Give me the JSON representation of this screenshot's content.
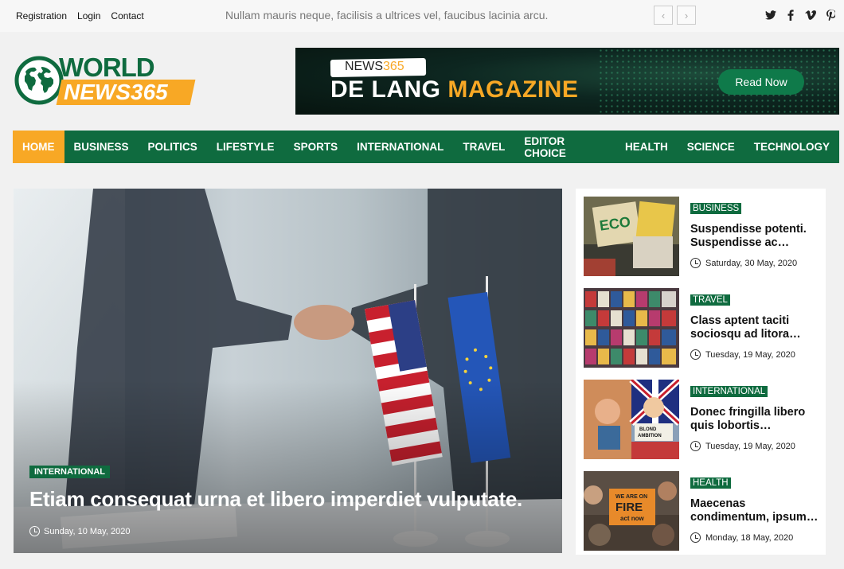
{
  "topbar": {
    "links": [
      "Registration",
      "Login",
      "Contact"
    ],
    "ticker": "Nullam mauris neque, facilisis a ultrices vel, faucibus lacinia arcu.",
    "prev": "‹",
    "next": "›",
    "social": [
      "twitter-icon",
      "facebook-icon",
      "vimeo-icon",
      "pinterest-icon"
    ]
  },
  "logo": {
    "line1": "WORLD",
    "line2": "NEWS365"
  },
  "banner": {
    "brand": "NEWS",
    "brand_num": "365",
    "title_a": "DE LANG ",
    "title_b": "MAGAZINE",
    "button": "Read Now"
  },
  "nav": [
    "HOME",
    "BUSINESS",
    "POLITICS",
    "LIFESTYLE",
    "SPORTS",
    "INTERNATIONAL",
    "TRAVEL",
    "EDITOR CHOICE",
    "HEALTH",
    "SCIENCE",
    "TECHNOLOGY"
  ],
  "hero": {
    "category": "INTERNATIONAL",
    "title": "Etiam consequat urna et libero imperdiet vulputate.",
    "date": "Sunday, 10 May, 2020"
  },
  "side": [
    {
      "category": "BUSINESS",
      "title": "Suspendisse potenti. Suspendisse ac…",
      "date": "Saturday, 30 May, 2020"
    },
    {
      "category": "TRAVEL",
      "title": "Class aptent taciti sociosqu ad litora…",
      "date": "Tuesday, 19 May, 2020"
    },
    {
      "category": "INTERNATIONAL",
      "title": "Donec fringilla libero quis lobortis…",
      "date": "Tuesday, 19 May, 2020"
    },
    {
      "category": "HEALTH",
      "title": "Maecenas condimentum, ipsum…",
      "date": "Monday, 18 May, 2020"
    }
  ],
  "colors": {
    "brand_green": "#0f6b3f",
    "accent_orange": "#f8a825"
  }
}
